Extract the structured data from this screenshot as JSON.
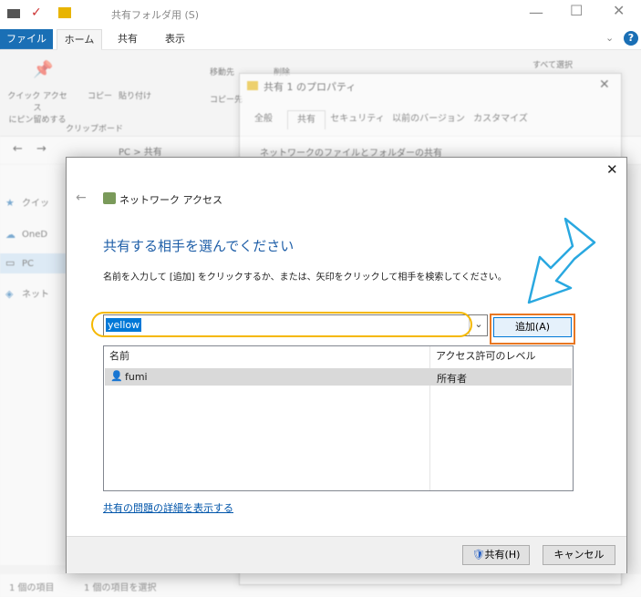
{
  "explorer": {
    "window_title": "共有フォルダ用 (S)",
    "ribbon_tabs": [
      "ファイル",
      "ホーム",
      "共有",
      "表示"
    ],
    "ribbon": {
      "quick_access_label": "クイック アクセス\nにピン留めする",
      "copy_label": "コピー",
      "paste_label": "貼り付け",
      "clipboard_group": "クリップボード",
      "move_to_label": "移動先",
      "copy_to_label": "コピー先",
      "delete_label": "削除",
      "select_all_label": "すべて選択"
    },
    "breadcrumb": "PC  >  共有",
    "sidebar": [
      "クイッ",
      "OneD",
      "PC",
      "ネット"
    ],
    "status_items": "1 個の項目",
    "status_selected": "1 個の項目を選択"
  },
  "properties": {
    "title": "共有 1 のプロパティ",
    "tabs": [
      "全般",
      "共有",
      "セキュリティ",
      "以前のバージョン",
      "カスタマイズ"
    ],
    "section": "ネットワークのファイルとフォルダーの共有"
  },
  "dialog": {
    "title": "ネットワーク アクセス",
    "heading": "共有する相手を選んでください",
    "instruction": "名前を入力して [追加] をクリックするか、または、矢印をクリックして相手を検索してください。",
    "input_value": "yellow",
    "add_button": "追加(A)",
    "columns": [
      "名前",
      "アクセス許可のレベル"
    ],
    "rows": [
      {
        "name": "fumi",
        "level": "所有者"
      }
    ],
    "help_link": "共有の問題の詳細を表示する",
    "share_button": "共有(H)",
    "cancel_button": "キャンセル"
  },
  "colors": {
    "accent_blue": "#0078d7",
    "heading_blue": "#1f5fa8",
    "highlight_yellow": "#f5b800",
    "highlight_orange": "#e87722",
    "arrow_blue": "#29a8e0"
  }
}
